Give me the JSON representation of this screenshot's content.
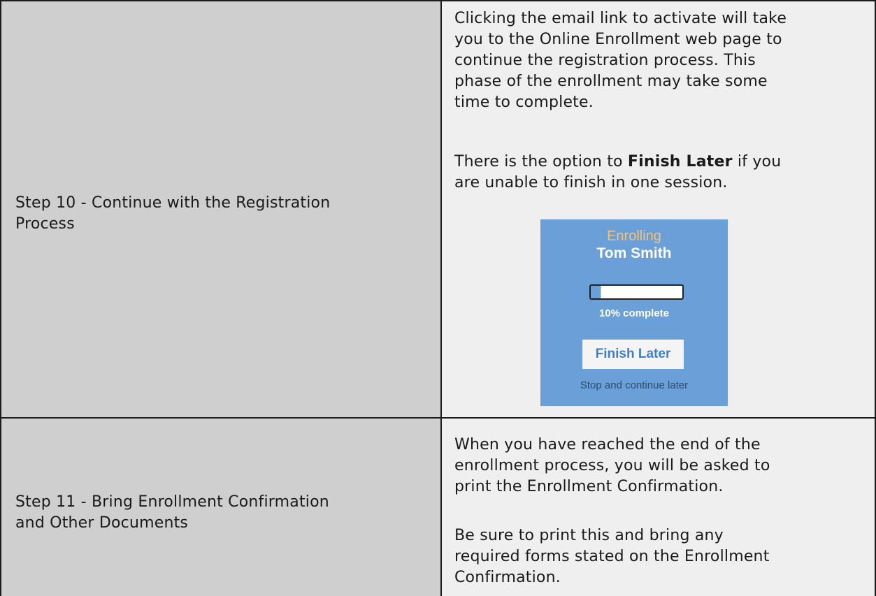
{
  "rows": [
    {
      "step": "Step 10 - Continue with the Registration Process",
      "step_lines": [
        "Step 10 - Continue with the Registration",
        "Process"
      ],
      "paragraph1_lines": [
        "Clicking the email link to activate will take",
        "you to the Online Enrollment web page to",
        "continue the registration process.  This",
        "phase of the enrollment may take some",
        "time to complete."
      ],
      "paragraph2_before": "There is the option to ",
      "paragraph2_bold": "Finish Later",
      "paragraph2_after": " if you",
      "paragraph2_line2": "are unable to finish in one session."
    },
    {
      "step": "Step 11 - Bring Enrollment Confirmation and Other Documents",
      "step_lines": [
        "Step 11 - Bring Enrollment Confirmation",
        "and Other Documents"
      ],
      "paragraph1_lines": [
        "When you have reached the end of the",
        "enrollment process, you will be asked to",
        "print the Enrollment Confirmation."
      ],
      "paragraph2_lines": [
        "Be sure to print this and bring any",
        "required forms stated on the Enrollment",
        "Confirmation."
      ]
    }
  ],
  "widget": {
    "status": "Enrolling",
    "name": "Tom Smith",
    "progress_label": "10% complete",
    "progress_value": 0.1,
    "button_label": "Finish Later",
    "caption": "Stop and continue later",
    "background_color": "#6a9fd8",
    "status_color": "#f7c27a",
    "button_text_color": "#3f7fc7"
  },
  "colors": {
    "left_cell": "#cfcfcf",
    "right_cell": "#efefef",
    "border": "#1a1a1a"
  }
}
